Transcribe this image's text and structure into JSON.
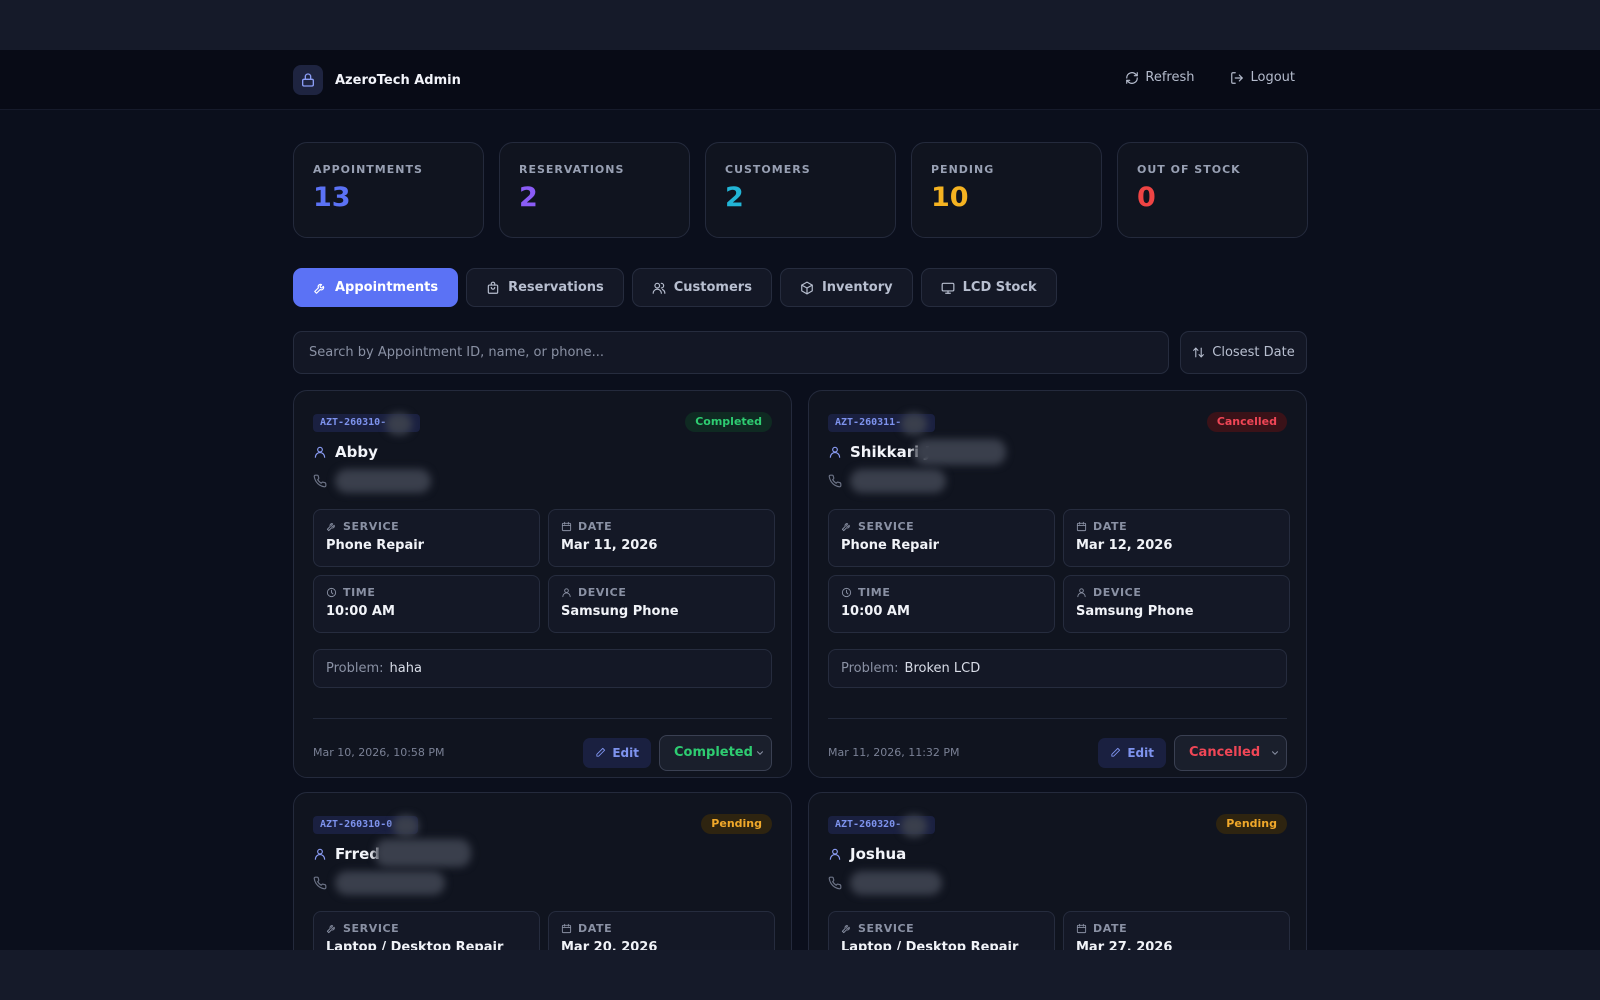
{
  "header": {
    "title": "AzeroTech Admin",
    "refresh_label": "Refresh",
    "logout_label": "Logout"
  },
  "stats": [
    {
      "label": "APPOINTMENTS",
      "value": "13",
      "color": "#5b72f5"
    },
    {
      "label": "RESERVATIONS",
      "value": "2",
      "color": "#8b5cf6"
    },
    {
      "label": "CUSTOMERS",
      "value": "2",
      "color": "#22b5d6"
    },
    {
      "label": "PENDING",
      "value": "10",
      "color": "#f5b321"
    },
    {
      "label": "OUT OF STOCK",
      "value": "0",
      "color": "#ef4444"
    }
  ],
  "tabs": [
    {
      "label": "Appointments",
      "icon": "wrench-icon",
      "active": true
    },
    {
      "label": "Reservations",
      "icon": "bag-icon",
      "active": false
    },
    {
      "label": "Customers",
      "icon": "users-icon",
      "active": false
    },
    {
      "label": "Inventory",
      "icon": "box-icon",
      "active": false
    },
    {
      "label": "LCD Stock",
      "icon": "monitor-icon",
      "active": false
    }
  ],
  "search": {
    "placeholder": "Search by Appointment ID, name, or phone...",
    "value": ""
  },
  "sort": {
    "label": "Closest Date"
  },
  "labels": {
    "service": "SERVICE",
    "date": "DATE",
    "time": "TIME",
    "device": "DEVICE",
    "problem": "Problem:",
    "edit": "Edit"
  },
  "appointments": [
    {
      "id": "AZT-260310-",
      "name": "Abby",
      "status": "Completed",
      "status_color": "#2ecc71",
      "service": "Phone Repair",
      "date": "Mar 11, 2026",
      "time": "10:00 AM",
      "device": "Samsung Phone",
      "problem": "haha",
      "created": "Mar 10, 2026, 10:58 PM"
    },
    {
      "id": "AZT-260311-",
      "name": "Shikkari J",
      "status": "Cancelled",
      "status_color": "#f04656",
      "service": "Phone Repair",
      "date": "Mar 12, 2026",
      "time": "10:00 AM",
      "device": "Samsung Phone",
      "problem": "Broken LCD",
      "created": "Mar 11, 2026, 11:32 PM"
    },
    {
      "id": "AZT-260310-0",
      "name": "Frred",
      "status": "Pending",
      "status_color": "#f0a82a",
      "service": "Laptop / Desktop Repair",
      "date": "Mar 20, 2026"
    },
    {
      "id": "AZT-260320-",
      "name": "Joshua",
      "status": "Pending",
      "status_color": "#f0a82a",
      "service": "Laptop / Desktop Repair",
      "date": "Mar 27, 2026"
    }
  ]
}
